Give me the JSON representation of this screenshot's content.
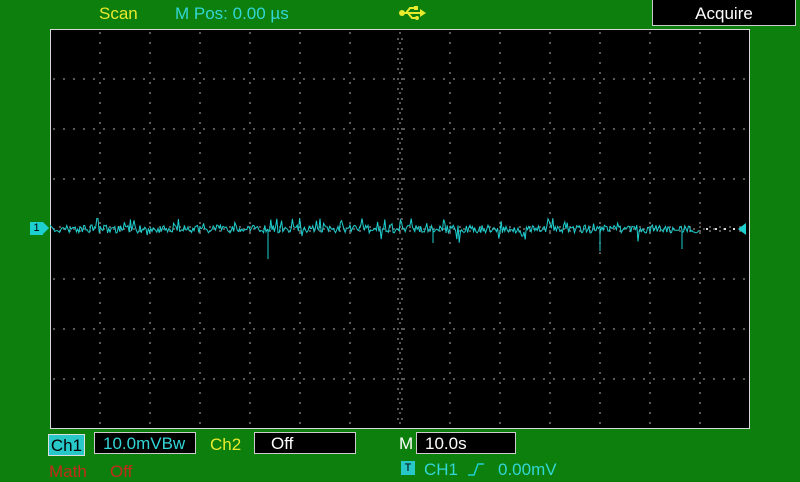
{
  "header": {
    "mode": "Scan",
    "m_pos": "M Pos: 0.00 µs",
    "acquire_label": "Acquire"
  },
  "channels": {
    "ch1": {
      "label": "Ch1",
      "scale": "10.0mVBw",
      "marker": "1"
    },
    "ch2": {
      "label": "Ch2",
      "scale": "Off"
    },
    "math": {
      "label": "Math",
      "value": "Off"
    }
  },
  "timebase": {
    "label": "M",
    "scale": "10.0s"
  },
  "trigger": {
    "badge": "T",
    "source": "CH1",
    "level": "0.00mV"
  },
  "colors": {
    "background": "#0c7f0c",
    "screen": "#000000",
    "ch1": "#1ecfcf",
    "yellow_text": "#e8ea2e",
    "math": "#c52b1d"
  },
  "icons": [
    "usb-icon",
    "rising-edge-icon"
  ]
}
